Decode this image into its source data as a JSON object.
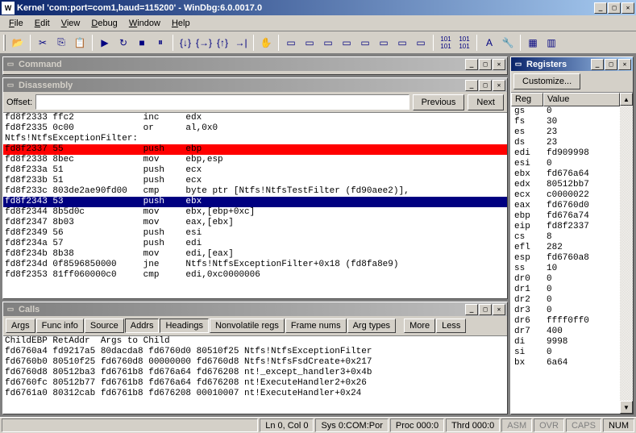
{
  "window": {
    "title": "Kernel 'com:port=com1,baud=115200' - WinDbg:6.0.0017.0"
  },
  "menu": [
    "File",
    "Edit",
    "View",
    "Debug",
    "Window",
    "Help"
  ],
  "panes": {
    "command": {
      "title": "Command"
    },
    "disassembly": {
      "title": "Disassembly",
      "offset_label": "Offset:",
      "previous": "Previous",
      "next": "Next",
      "lines": [
        {
          "text": "fd8f2333 ffc2             inc     edx",
          "cls": ""
        },
        {
          "text": "fd8f2335 0c00             or      al,0x0",
          "cls": ""
        },
        {
          "text": "Ntfs!NtfsExceptionFilter:",
          "cls": ""
        },
        {
          "text": "fd8f2337 55               push    ebp",
          "cls": "red"
        },
        {
          "text": "fd8f2338 8bec             mov     ebp,esp",
          "cls": ""
        },
        {
          "text": "fd8f233a 51               push    ecx",
          "cls": ""
        },
        {
          "text": "fd8f233b 51               push    ecx",
          "cls": ""
        },
        {
          "text": "fd8f233c 803de2ae90fd00   cmp     byte ptr [Ntfs!NtfsTestFilter (fd90aee2)],",
          "cls": ""
        },
        {
          "text": "fd8f2343 53               push    ebx",
          "cls": "blue"
        },
        {
          "text": "fd8f2344 8b5d0c           mov     ebx,[ebp+0xc]",
          "cls": ""
        },
        {
          "text": "fd8f2347 8b03             mov     eax,[ebx]",
          "cls": ""
        },
        {
          "text": "fd8f2349 56               push    esi",
          "cls": ""
        },
        {
          "text": "fd8f234a 57               push    edi",
          "cls": ""
        },
        {
          "text": "fd8f234b 8b38             mov     edi,[eax]",
          "cls": ""
        },
        {
          "text": "fd8f234d 0f8596850000     jne     Ntfs!NtfsExceptionFilter+0x18 (fd8fa8e9)",
          "cls": ""
        },
        {
          "text": "fd8f2353 81ff060000c0     cmp     edi,0xc0000006",
          "cls": ""
        }
      ]
    },
    "calls": {
      "title": "Calls",
      "tabs": [
        "Args",
        "Func info",
        "Source",
        "Addrs",
        "Headings",
        "Nonvolatile regs",
        "Frame nums",
        "Arg types"
      ],
      "pressed": [
        false,
        false,
        false,
        true,
        true,
        false,
        false,
        false
      ],
      "more": "More",
      "less": "Less",
      "header": "ChildEBP RetAddr  Args to Child",
      "rows": [
        "fd6760a4 fd9217a5 80dacda8 fd6760d0 80510f25 Ntfs!NtfsExceptionFilter",
        "fd6760b0 80510f25 fd6760d8 00000000 fd6760d8 Ntfs!NtfsFsdCreate+0x217",
        "fd6760d8 80512ba3 fd6761b8 fd676a64 fd676208 nt!_except_handler3+0x4b",
        "fd6760fc 80512b77 fd6761b8 fd676a64 fd676208 nt!ExecuteHandler2+0x26",
        "fd6761a0 80312cab fd6761b8 fd676208 00010007 nt!ExecuteHandler+0x24"
      ]
    },
    "registers": {
      "title": "Registers",
      "customize": "Customize...",
      "col1": "Reg",
      "col2": "Value",
      "rows": [
        {
          "r": "gs",
          "v": "0"
        },
        {
          "r": "fs",
          "v": "30"
        },
        {
          "r": "es",
          "v": "23"
        },
        {
          "r": "ds",
          "v": "23"
        },
        {
          "r": "edi",
          "v": "fd909998"
        },
        {
          "r": "esi",
          "v": "0"
        },
        {
          "r": "ebx",
          "v": "fd676a64"
        },
        {
          "r": "edx",
          "v": "80512bb7"
        },
        {
          "r": "ecx",
          "v": "c0000022"
        },
        {
          "r": "eax",
          "v": "fd6760d0"
        },
        {
          "r": "ebp",
          "v": "fd676a74"
        },
        {
          "r": "eip",
          "v": "fd8f2337"
        },
        {
          "r": "cs",
          "v": "8"
        },
        {
          "r": "efl",
          "v": "282"
        },
        {
          "r": "esp",
          "v": "fd6760a8"
        },
        {
          "r": "ss",
          "v": "10"
        },
        {
          "r": "dr0",
          "v": "0"
        },
        {
          "r": "dr1",
          "v": "0"
        },
        {
          "r": "dr2",
          "v": "0"
        },
        {
          "r": "dr3",
          "v": "0"
        },
        {
          "r": "dr6",
          "v": "ffff0ff0"
        },
        {
          "r": "dr7",
          "v": "400"
        },
        {
          "r": "di",
          "v": "9998"
        },
        {
          "r": "si",
          "v": "0"
        },
        {
          "r": "bx",
          "v": "6a64"
        }
      ]
    }
  },
  "status": {
    "ln": "Ln 0, Col 0",
    "sys": "Sys 0:COM:Por",
    "proc": "Proc 000:0",
    "thrd": "Thrd 000:0",
    "asm": "ASM",
    "ovr": "OVR",
    "caps": "CAPS",
    "num": "NUM"
  }
}
